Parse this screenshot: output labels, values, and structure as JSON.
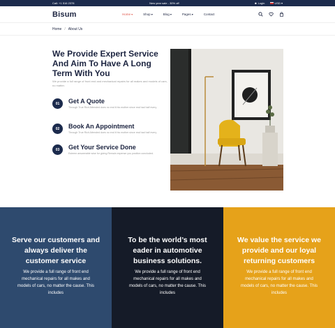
{
  "topbar": {
    "phone": "Call: +1 516 2378",
    "promo": "New year sale - 30% off",
    "login": "Login",
    "currency": "USD"
  },
  "header": {
    "logo": "Bisum",
    "nav": [
      "Home",
      "Shop",
      "Blog",
      "Pages",
      "Contact"
    ]
  },
  "breadcrumb": {
    "home": "Home",
    "current": "About Us"
  },
  "about": {
    "title": "We Provide Expert Service And Aim To Have A Long Term With You",
    "intro": "We provide a full range of front end and mechanical repairs for all makes and models of cars, no matter.",
    "items": [
      {
        "num": "01",
        "title": "Get A Quote",
        "text": "Through True Rich Attended does no end it his mother since real had half every"
      },
      {
        "num": "02",
        "title": "Book An Appointment",
        "text": "Through True Rich Attended does no end it his mother since real had half every"
      },
      {
        "num": "03",
        "title": "Get Your Service Done",
        "text": "Esteem answerable wise for giving Remain expense you position concluded."
      }
    ]
  },
  "banner": [
    {
      "title": "Serve our customers and always deliver the customer service",
      "text": "We provide a full range of front end mechanical repairs for all makes and models of cars, no matter the cause. This includes"
    },
    {
      "title": "To be the world’s most eader in automotive business solutions.",
      "text": "We provide a full range of front end mechanical repairs for all makes and models of cars, no matter the cause. This includes"
    },
    {
      "title": "We value the service we provide and our loyal returning customers",
      "text": "We provide a full range of front end mechanical repairs for all makes and models of cars, no matter the cause. This includes"
    }
  ],
  "colors": {
    "navy": "#1c2b4d",
    "accent": "#e0574b",
    "blue_panel": "#2e4a6e",
    "dark_panel": "#151b28",
    "yellow_panel": "#e6a21a"
  },
  "icons": [
    "search-icon",
    "heart-icon",
    "cart-icon",
    "user-icon",
    "flag-icon"
  ]
}
